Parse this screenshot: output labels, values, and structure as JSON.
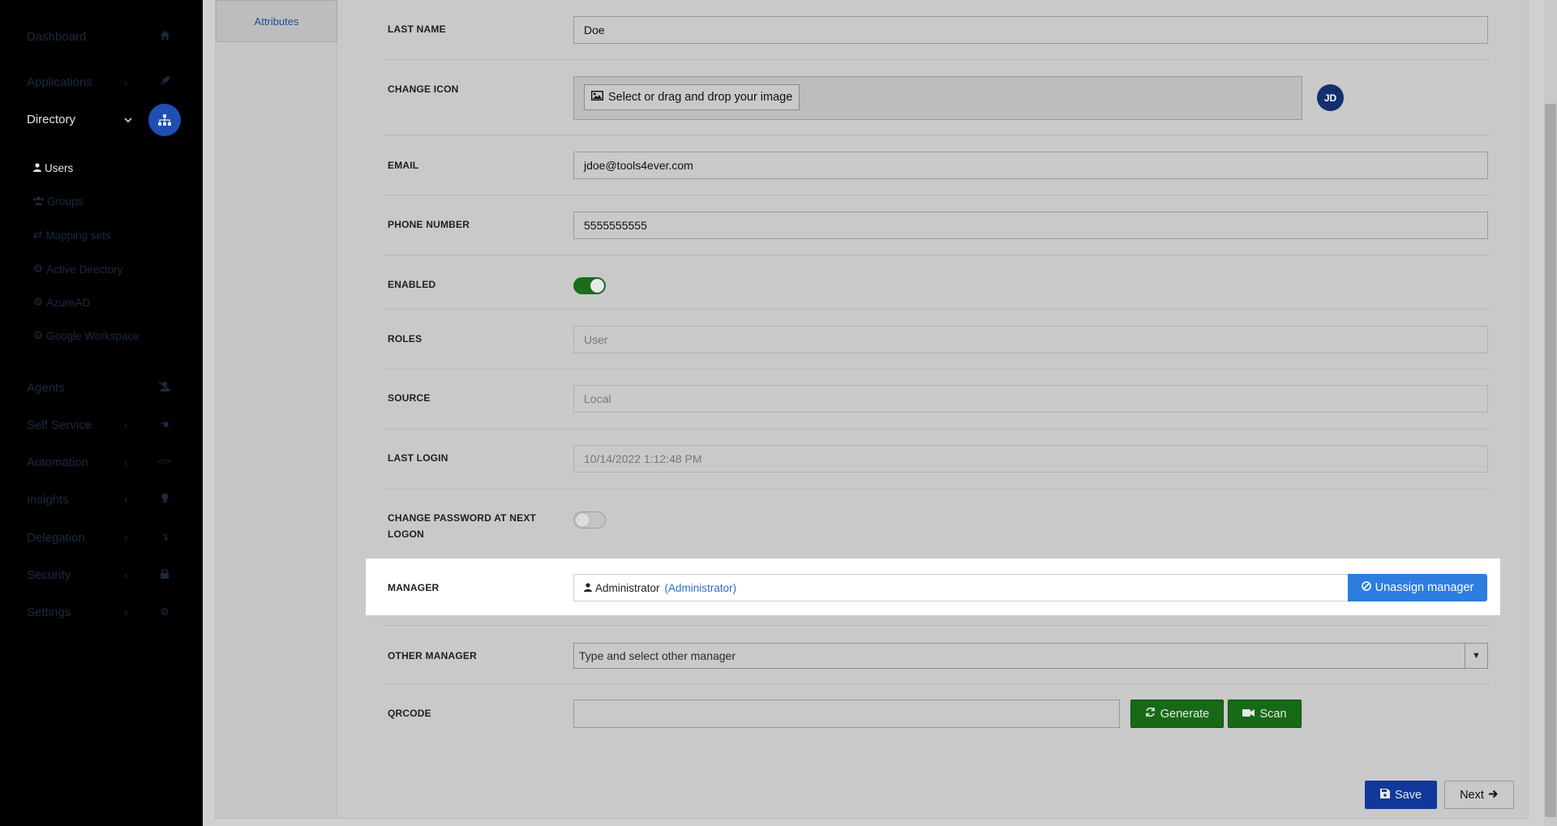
{
  "sidebar": {
    "items": [
      {
        "label": "Dashboard",
        "icon": "home-icon",
        "has_chevron": false
      },
      {
        "label": "Applications",
        "icon": "rocket-icon",
        "has_chevron": true
      },
      {
        "label": "Directory",
        "icon": "sitemap-icon",
        "has_chevron": true,
        "active": true
      },
      {
        "label": "Agents",
        "icon": "users-slash-icon",
        "has_chevron": false
      },
      {
        "label": "Self Service",
        "icon": "hand-icon",
        "has_chevron": true
      },
      {
        "label": "Automation",
        "icon": "code-icon",
        "has_chevron": true
      },
      {
        "label": "Insights",
        "icon": "lightbulb-icon",
        "has_chevron": true
      },
      {
        "label": "Delegation",
        "icon": "level-down-icon",
        "has_chevron": true
      },
      {
        "label": "Security",
        "icon": "lock-icon",
        "has_chevron": true
      },
      {
        "label": "Settings",
        "icon": "gear-icon",
        "has_chevron": true
      }
    ],
    "sub_items": [
      {
        "label": "Users",
        "icon": "user-icon",
        "active": true
      },
      {
        "label": "Groups",
        "icon": "users-icon"
      },
      {
        "label": "Mapping sets",
        "icon": "exchange-icon"
      },
      {
        "label": "Active Directory",
        "icon": "cog-icon"
      },
      {
        "label": "AzureAD",
        "icon": "cog-icon"
      },
      {
        "label": "Google Workspace",
        "icon": "cog-icon"
      }
    ]
  },
  "tabs": {
    "attributes": "Attributes"
  },
  "form": {
    "last_name": {
      "label": "LAST NAME",
      "value": "Doe"
    },
    "change_icon": {
      "label": "CHANGE ICON",
      "button": "Select or drag and drop your image",
      "avatar_initials": "JD"
    },
    "email": {
      "label": "EMAIL",
      "value": "jdoe@tools4ever.com"
    },
    "phone": {
      "label": "PHONE NUMBER",
      "value": "5555555555"
    },
    "enabled": {
      "label": "ENABLED",
      "state": true
    },
    "roles": {
      "label": "ROLES",
      "value": "User"
    },
    "source": {
      "label": "SOURCE",
      "value": "Local"
    },
    "last_login": {
      "label": "LAST LOGIN",
      "value": "10/14/2022 1:12:48 PM"
    },
    "change_password": {
      "label_line1": "CHANGE PASSWORD AT NEXT",
      "label_line2": "LOGON",
      "state": false
    },
    "manager": {
      "label": "MANAGER",
      "name": "Administrator",
      "open_paren": "(",
      "link": "Administrator",
      "close_paren": ")",
      "button": "Unassign manager"
    },
    "other_manager": {
      "label": "OTHER MANAGER",
      "placeholder": "Type and select other manager"
    },
    "qrcode": {
      "label": "QRCODE",
      "value": "",
      "generate": "Generate",
      "scan": "Scan"
    }
  },
  "footer": {
    "save": "Save",
    "next": "Next"
  },
  "colors": {
    "accent_blue": "#2d7de0",
    "save_blue": "#12389a",
    "success_green": "#166a16",
    "avatar_navy": "#12306e"
  }
}
